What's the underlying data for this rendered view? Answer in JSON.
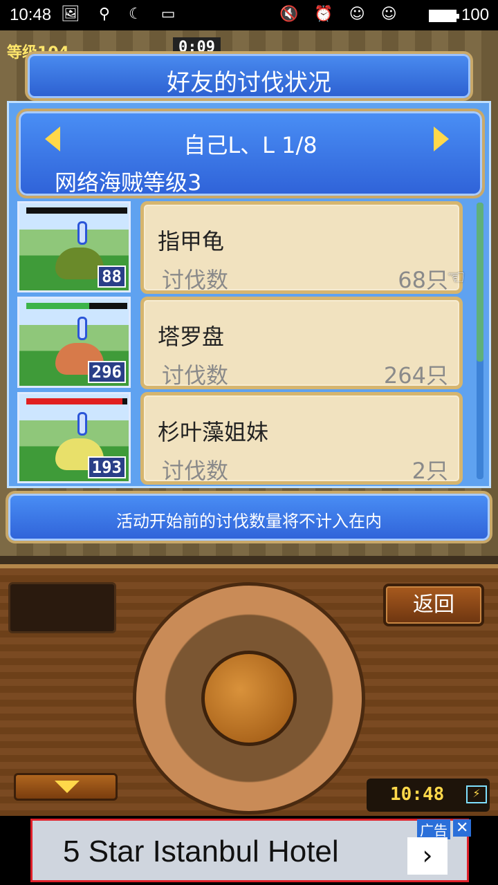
{
  "status_bar": {
    "time": "10:48",
    "left_icons": "🖼 ⚲ ☾ ▭",
    "right_icons": "🔇 ⏰ ☺ ☺",
    "battery_level": "100"
  },
  "hud": {
    "level_text": "等级104",
    "timer_text": "0:09"
  },
  "dialog": {
    "title": "好友的讨伐状况",
    "friend_line": "自己L、L 1/8",
    "pirate_level": "网络海贼等级3",
    "notice": "活动开始前的讨伐数量将不计入在内"
  },
  "entries": [
    {
      "name": "指甲龟",
      "label": "讨伐数",
      "count": "68只",
      "badge": "88",
      "hp_color": "#111111",
      "hp_fraction": 0.0,
      "monster_color": "#6a8a2a"
    },
    {
      "name": "塔罗盘",
      "label": "讨伐数",
      "count": "264只",
      "badge": "296",
      "hp_color": "#3cb44a",
      "hp_fraction": 0.62,
      "monster_color": "#d77a4a"
    },
    {
      "name": "杉叶藻姐妹",
      "label": "讨伐数",
      "count": "2只",
      "badge": "193",
      "hp_color": "#e02020",
      "hp_fraction": 0.95,
      "monster_color": "#e8e06a"
    }
  ],
  "controls": {
    "back_label": "返回",
    "clock": "10:48",
    "clock_battery": "⚡"
  },
  "ad": {
    "text": "5 Star Istanbul Hotel",
    "tag": "广告",
    "close": "✕",
    "arrow": "›"
  }
}
